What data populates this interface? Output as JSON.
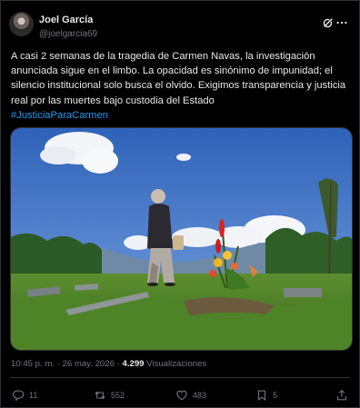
{
  "author": {
    "name": "Joel García",
    "handle": "@joelgarcia69"
  },
  "post": {
    "text": "A casi 2 semanas de la tragedia de Carmen Navas, la investigación anunciada sigue en el limbo. La opacidad es sinónimo de impunidad; el silencio institucional solo busca el olvido. Exigimos transparencia y justicia real por las muertes bajo custodia del Estado",
    "hashtag": "#JusticiaParaCarmen",
    "timestamp": "10:45 p. m. · 26 may. 2026 · ",
    "views_count": "4.299",
    "views_label": " Visualizaciones"
  },
  "actions": {
    "replies": "11",
    "reposts": "552",
    "likes": "483",
    "bookmarks": "5"
  },
  "icons": [
    "avatar",
    "grok-icon",
    "more-icon",
    "reply-icon",
    "repost-icon",
    "like-icon",
    "bookmark-icon",
    "share-icon"
  ],
  "colors": {
    "background": "#000000",
    "text": "#e7e9ea",
    "muted": "#71767b",
    "link": "#1d9bf0",
    "border": "#2f3336"
  }
}
